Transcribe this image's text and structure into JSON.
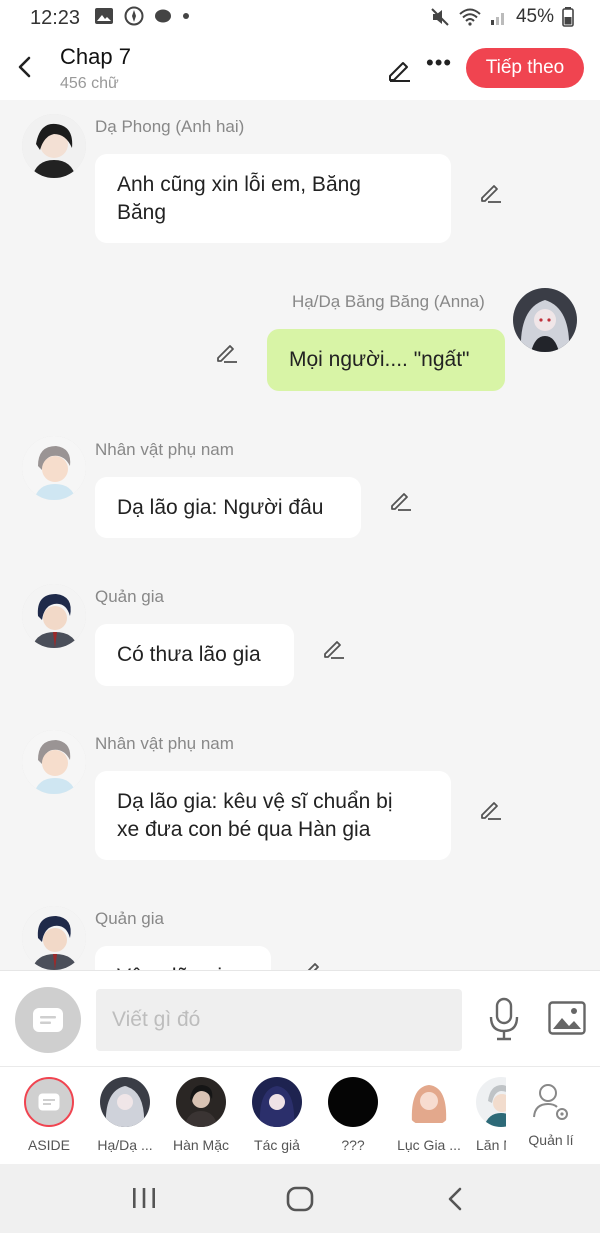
{
  "status": {
    "time": "12:23",
    "battery": "45%"
  },
  "header": {
    "title": "Chap 7",
    "subtitle": "456 chữ",
    "next_label": "Tiếp theo"
  },
  "messages": [
    {
      "sender": "Dạ Phong (Anh hai)",
      "line1": "Anh cũng xin lỗi em, Băng",
      "line2": "Băng"
    },
    {
      "sender": "Hạ/Dạ Băng Băng (Anna)",
      "text": "Mọi người.... \"ngất\""
    },
    {
      "sender": "Nhân vật phụ nam",
      "text": "Dạ lão gia: Người đâu"
    },
    {
      "sender": "Quản gia",
      "text": "Có thưa lão gia"
    },
    {
      "sender": "Nhân vật phụ nam",
      "line1": "Dạ lão gia: kêu vệ sĩ chuẩn bị",
      "line2": "xe đưa con bé qua Hàn gia"
    },
    {
      "sender": "Quản gia",
      "text": "Vâng lão gia"
    }
  ],
  "composer": {
    "placeholder": "Viết gì đó"
  },
  "characters": [
    {
      "label": "ASIDE"
    },
    {
      "label": "Hạ/Dạ ..."
    },
    {
      "label": "Hàn Mặc"
    },
    {
      "label": "Tác giả"
    },
    {
      "label": "???"
    },
    {
      "label": "Lục Gia ..."
    },
    {
      "label": "Lăn N"
    },
    {
      "label": "Quản lí"
    }
  ],
  "colors": {
    "accent": "#f04450",
    "my_bubble": "#d8f4a6",
    "background": "#f5f5f5"
  }
}
